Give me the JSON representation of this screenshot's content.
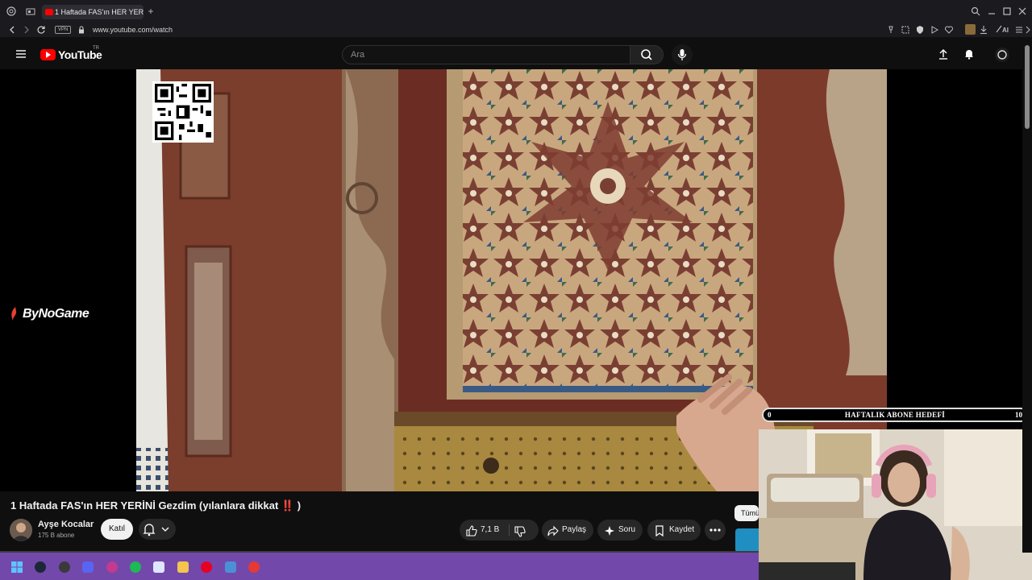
{
  "browser": {
    "tab_title": "1 Haftada FAS'ın HER YERİN",
    "new_tab_glyph": "+",
    "vpn_label": "VPN",
    "url": "www.youtube.com/watch",
    "ai_label": "AI"
  },
  "youtube": {
    "logo_text": "YouTube",
    "country_code": "TR",
    "search_placeholder": "Ara"
  },
  "overlay": {
    "brand": "ByNoGame",
    "goal_left": "0",
    "goal_label": "HAFTALIK ABONE HEDEFİ",
    "goal_right": "10"
  },
  "video": {
    "title": "1 Haftada FAS'ın HER YERİNİ Gezdim (yılanlara dikkat ‼️ )",
    "channel_name": "Ayşe Kocalar",
    "subscribers": "175 B abone",
    "join_label": "Katıl",
    "like_count": "7,1 B",
    "share_label": "Paylaş",
    "ask_label": "Soru",
    "save_label": "Kaydet",
    "chip_all": "Tümü"
  },
  "colors": {
    "youtube_red": "#ff0000",
    "taskbar": "#7348ab",
    "background": "#0f0f0f"
  }
}
